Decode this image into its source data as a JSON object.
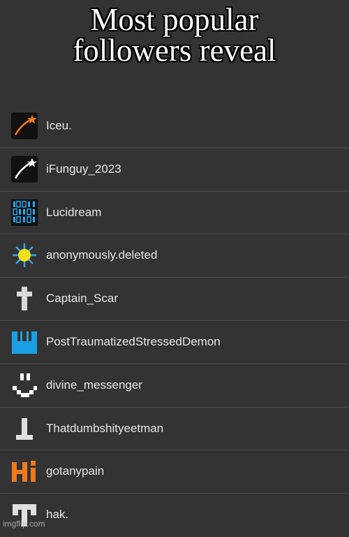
{
  "caption": {
    "line1": "Most popular",
    "line2": "followers reveal"
  },
  "followers": [
    {
      "name": "Iceu.",
      "icon": "shooting-star-orange-icon"
    },
    {
      "name": "iFunguy_2023",
      "icon": "shooting-star-white-icon"
    },
    {
      "name": "Lucidream",
      "icon": "binary-code-icon"
    },
    {
      "name": "anonymously.deleted",
      "icon": "sun-icon"
    },
    {
      "name": "Captain_Scar",
      "icon": "cross-icon"
    },
    {
      "name": "PostTraumatizedStressedDemon",
      "icon": "blue-castle-icon"
    },
    {
      "name": "divine_messenger",
      "icon": "pixel-smiley-icon"
    },
    {
      "name": "Thatdumbshityeetman",
      "icon": "inverted-t-icon"
    },
    {
      "name": "gotanypain",
      "icon": "orange-hi-icon"
    },
    {
      "name": "hak.",
      "icon": "pixel-t-icon"
    }
  ],
  "watermark": "imgflip.com",
  "colors": {
    "background": "#333333",
    "divider": "#4e4e4e",
    "text": "#e6e6e6",
    "accent_orange": "#f07a1a",
    "accent_blue": "#1aa0e6"
  }
}
